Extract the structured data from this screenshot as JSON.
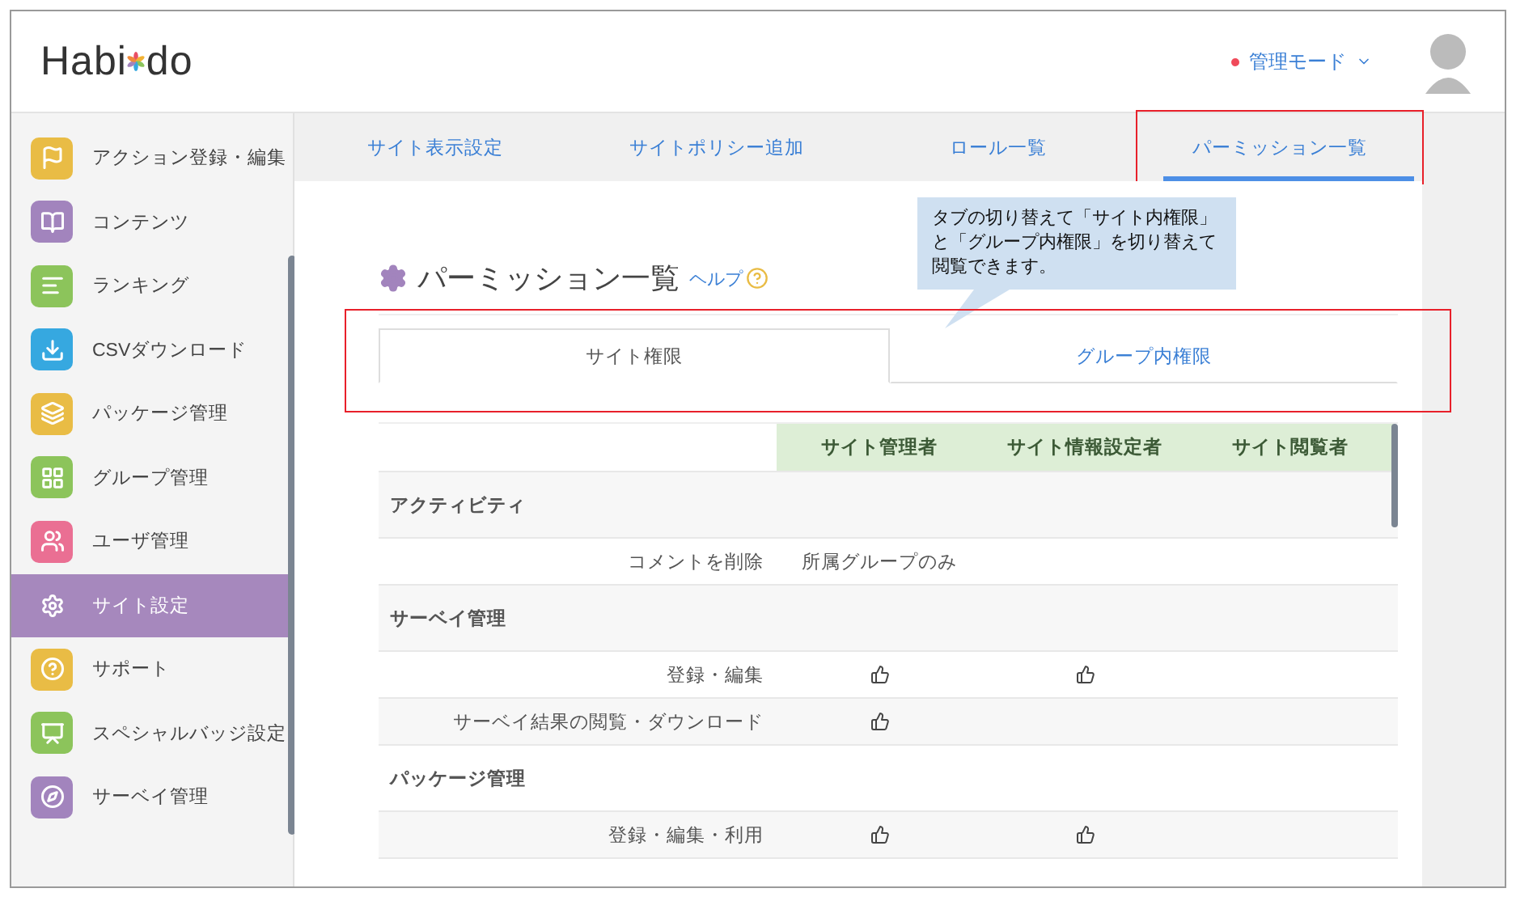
{
  "header": {
    "logo": {
      "left": "Habi",
      "right": "do"
    },
    "mode_menu": {
      "label": "管理モード"
    }
  },
  "sidebar": {
    "items": [
      {
        "label": "アクション登録・編集",
        "selected": false,
        "color": "#e9bc45"
      },
      {
        "label": "コンテンツ",
        "selected": false,
        "color": "#a284bd"
      },
      {
        "label": "ランキング",
        "selected": false,
        "color": "#8cc45b"
      },
      {
        "label": "CSVダウンロード",
        "selected": false,
        "color": "#36a8e0"
      },
      {
        "label": "パッケージ管理",
        "selected": false,
        "color": "#e9bc45"
      },
      {
        "label": "グループ管理",
        "selected": false,
        "color": "#8cc45b"
      },
      {
        "label": "ユーザ管理",
        "selected": false,
        "color": "#ea6f93"
      },
      {
        "label": "サイト設定",
        "selected": true
      },
      {
        "label": "サポート",
        "selected": false,
        "color": "#e9bc45"
      },
      {
        "label": "スペシャルバッジ設定",
        "selected": false,
        "color": "#8cc45b"
      },
      {
        "label": "サーベイ管理",
        "selected": false,
        "color": "#a284bd"
      }
    ]
  },
  "tabs": [
    {
      "label": "サイト表示設定",
      "selected": false,
      "highlighted": false
    },
    {
      "label": "サイトポリシー追加",
      "selected": false,
      "highlighted": false
    },
    {
      "label": "ロール一覧",
      "selected": false,
      "highlighted": false
    },
    {
      "label": "パーミッション一覧",
      "selected": true,
      "highlighted": true
    }
  ],
  "page": {
    "title": "パーミッション一覧",
    "help_link": "ヘルプ"
  },
  "callout": {
    "text": "タブの切り替えて「サイト内権限」と「グループ内権限」を切り替えて閲覧できます。"
  },
  "sub_tabs": {
    "highlighted": true,
    "items": [
      {
        "label": "サイト権限",
        "selected": true
      },
      {
        "label": "グループ内権限",
        "selected": false
      }
    ]
  },
  "table": {
    "columns": [
      "サイト管理者",
      "サイト情報設定者",
      "サイト閲覧者"
    ],
    "rows": [
      {
        "kind": "section",
        "label": "アクティビティ"
      },
      {
        "kind": "item",
        "label": "コメントを削除",
        "cells": [
          {
            "kind": "text",
            "text": "所属グループのみ"
          },
          {
            "kind": "empty"
          },
          {
            "kind": "empty"
          }
        ]
      },
      {
        "kind": "section",
        "label": "サーベイ管理"
      },
      {
        "kind": "item",
        "label": "登録・編集",
        "cells": [
          {
            "kind": "thumb"
          },
          {
            "kind": "thumb"
          },
          {
            "kind": "empty"
          }
        ]
      },
      {
        "kind": "item",
        "label": "サーベイ結果の閲覧・ダウンロード",
        "cells": [
          {
            "kind": "thumb"
          },
          {
            "kind": "empty"
          },
          {
            "kind": "empty"
          }
        ]
      },
      {
        "kind": "section",
        "label": "パッケージ管理"
      },
      {
        "kind": "item",
        "label": "登録・編集・利用",
        "cells": [
          {
            "kind": "thumb"
          },
          {
            "kind": "thumb"
          },
          {
            "kind": "empty"
          }
        ]
      }
    ]
  }
}
